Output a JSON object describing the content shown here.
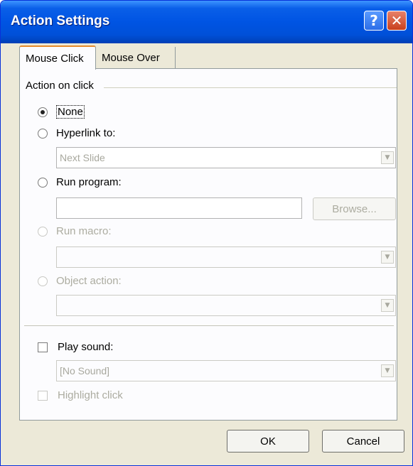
{
  "window": {
    "title": "Action Settings",
    "help_glyph": "?",
    "close_glyph": "✕"
  },
  "tabs": [
    {
      "label": "Mouse Click",
      "active": true
    },
    {
      "label": "Mouse Over",
      "active": false
    }
  ],
  "group": {
    "title": "Action on click"
  },
  "options": {
    "none": {
      "label": "None",
      "selected": true
    },
    "hyperlink": {
      "label": "Hyperlink to:",
      "value": "Next Slide",
      "enabled": true
    },
    "run_program": {
      "label": "Run program:",
      "value": "",
      "browse_label": "Browse...",
      "enabled": true
    },
    "run_macro": {
      "label": "Run macro:",
      "value": "",
      "enabled": false
    },
    "object_action": {
      "label": "Object action:",
      "value": "",
      "enabled": false
    }
  },
  "play_sound": {
    "label": "Play sound:",
    "checked": false,
    "value": "[No Sound]"
  },
  "highlight_click": {
    "label": "Highlight click",
    "checked": false,
    "enabled": false
  },
  "buttons": {
    "ok": "OK",
    "cancel": "Cancel"
  },
  "icons": {
    "dropdown": "▼",
    "radio": "radio-button",
    "checkbox": "checkbox"
  },
  "colors": {
    "titlebar": "#0054e3",
    "dialog_bg": "#ece9d8",
    "panel_bg": "#fcfcfe",
    "tab_accent": "#e68b2c"
  }
}
